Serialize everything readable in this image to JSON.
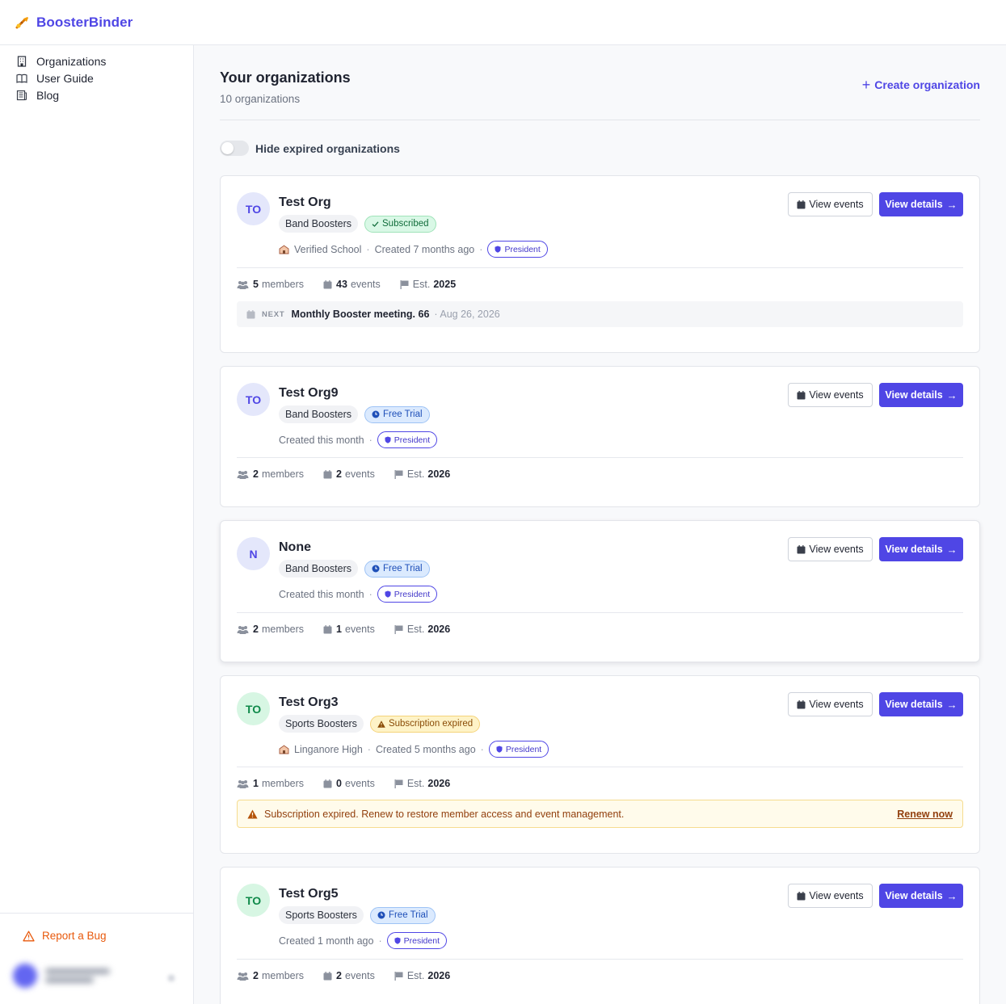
{
  "app": {
    "brand": "BoosterBinder"
  },
  "sidebar": {
    "items": [
      {
        "label": "Organizations",
        "icon": "building-icon"
      },
      {
        "label": "User Guide",
        "icon": "book-icon"
      },
      {
        "label": "Blog",
        "icon": "newspaper-icon"
      }
    ],
    "report_bug": "Report a Bug"
  },
  "header": {
    "title": "Your organizations",
    "count": "10 organizations",
    "create_label": "Create organization"
  },
  "filter": {
    "hide_expired_label": "Hide expired organizations",
    "hide_expired_on": false
  },
  "buttons": {
    "view_events": "View events",
    "view_details": "View details"
  },
  "orgs": [
    {
      "initials": "TO",
      "name": "Test Org",
      "type": "Band Boosters",
      "status": "Subscribed",
      "status_kind": "subscribed",
      "school": "Verified School",
      "created": "Created 7 months ago",
      "role": "President",
      "stats": {
        "members": "5",
        "members_label": "members",
        "events": "43",
        "events_label": "events",
        "est_label": "Est.",
        "est": "2025"
      },
      "next": {
        "label": "NEXT",
        "title": "Monthly Booster meeting. 66",
        "date": "· Aug 26, 2026"
      }
    },
    {
      "initials": "TO",
      "name": "Test Org9",
      "type": "Band Boosters",
      "status": "Free Trial",
      "status_kind": "trial",
      "created": "Created this month",
      "role": "President",
      "stats": {
        "members": "2",
        "members_label": "members",
        "events": "2",
        "events_label": "events",
        "est_label": "Est.",
        "est": "2026"
      }
    },
    {
      "initials": "N",
      "name": "None",
      "type": "Band Boosters",
      "status": "Free Trial",
      "status_kind": "trial",
      "created": "Created this month",
      "role": "President",
      "stats": {
        "members": "2",
        "members_label": "members",
        "events": "1",
        "events_label": "events",
        "est_label": "Est.",
        "est": "2026"
      }
    },
    {
      "initials": "TO",
      "name": "Test Org3",
      "type": "Sports Boosters",
      "status": "Subscription expired",
      "status_kind": "expired",
      "school": "Linganore High",
      "created": "Created 5 months ago",
      "role": "President",
      "stats": {
        "members": "1",
        "members_label": "members",
        "events": "0",
        "events_label": "events",
        "est_label": "Est.",
        "est": "2026"
      },
      "warning": {
        "text": "Subscription expired. Renew to restore member access and event management.",
        "link": "Renew now"
      }
    },
    {
      "initials": "TO",
      "name": "Test Org5",
      "type": "Sports Boosters",
      "status": "Free Trial",
      "status_kind": "trial",
      "created": "Created 1 month ago",
      "role": "President",
      "stats": {
        "members": "2",
        "members_label": "members",
        "events": "2",
        "events_label": "events",
        "est_label": "Est.",
        "est": "2026"
      }
    }
  ],
  "colors": {
    "accent": "#4f46e5",
    "subscribed": "#116d3b",
    "trial": "#1e4fb8",
    "expired": "#8a4b06",
    "report": "#e8590c"
  }
}
